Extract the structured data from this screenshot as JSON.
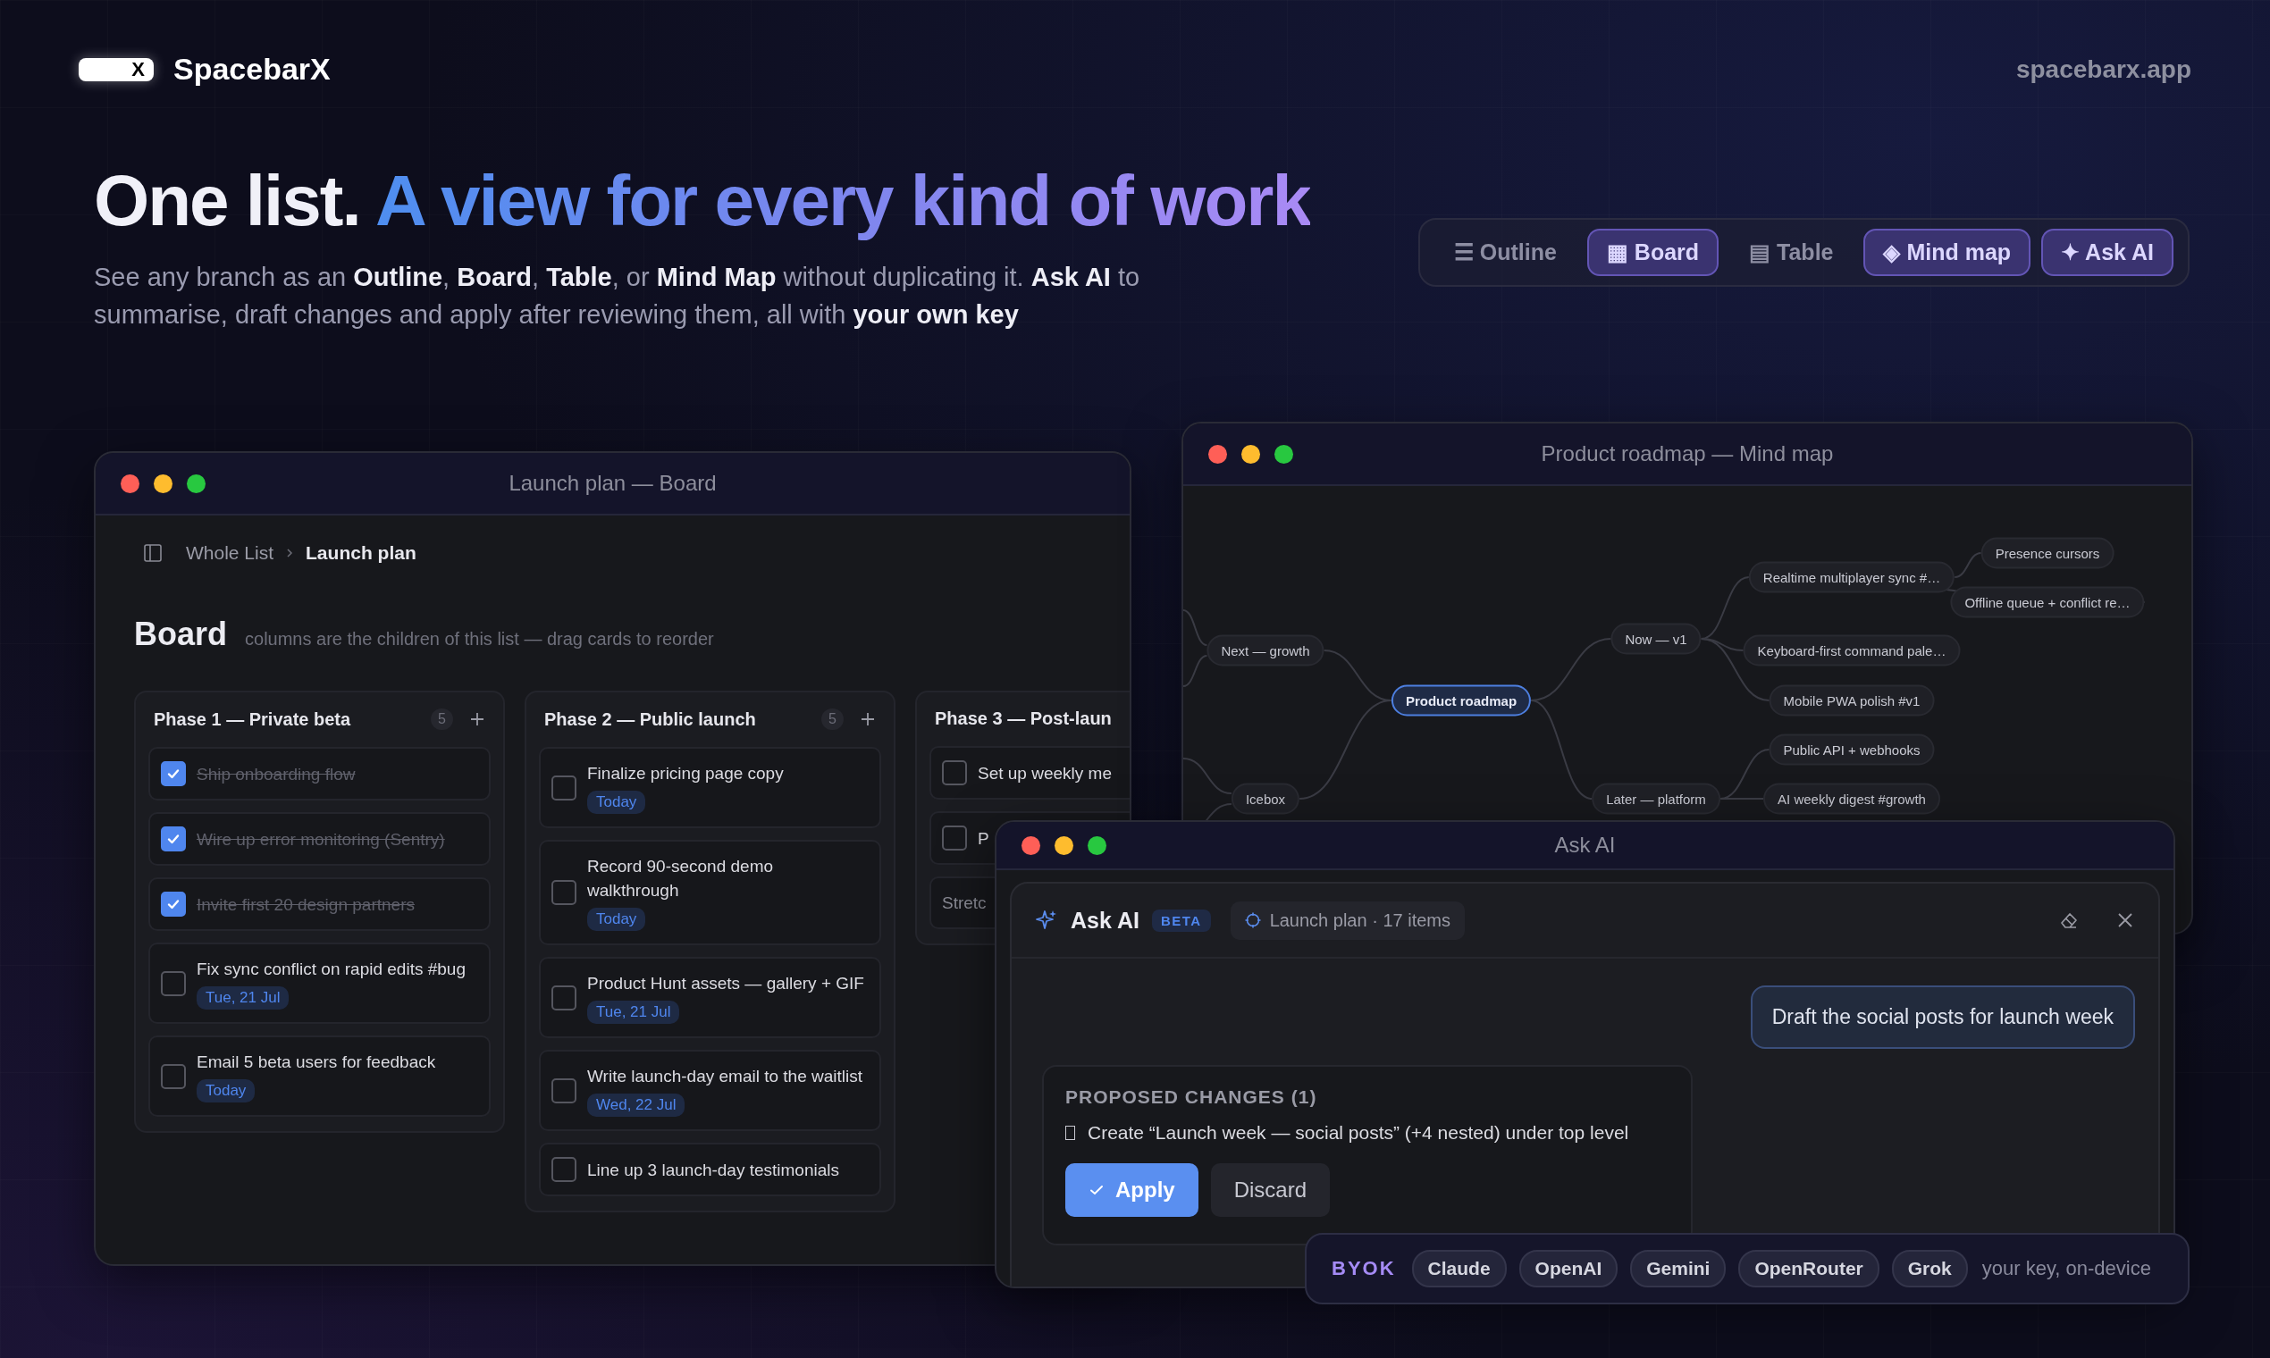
{
  "brand": {
    "mark": "X",
    "name": "SpacebarX",
    "domain": "spacebarx.app"
  },
  "hero": {
    "lead": "One list.",
    "accent": "A view for every kind of work",
    "subtitle": "See any branch as an **Outline**, **Board**, **Table**, or **Mind Map** without duplicating it. **Ask AI** to summarise, draft changes and apply after reviewing them, all with **your own key**"
  },
  "views": [
    {
      "icon": "☰",
      "label": "Outline",
      "selected": false
    },
    {
      "icon": "▦",
      "label": "Board",
      "selected": true
    },
    {
      "icon": "▤",
      "label": "Table",
      "selected": false
    },
    {
      "icon": "◈",
      "label": "Mind map",
      "selected": true
    },
    {
      "icon": "✦",
      "label": "Ask AI",
      "selected": true
    }
  ],
  "board_window": {
    "title": "Launch plan — Board",
    "breadcrumb": [
      {
        "label": "Whole List",
        "current": false
      },
      {
        "label": "Launch plan",
        "current": true
      }
    ],
    "heading": "Board",
    "hint": "columns are the children of this list — drag cards to reorder",
    "columns": [
      {
        "title": "Phase 1 — Private beta",
        "count": "5",
        "cards": [
          {
            "text": "Ship onboarding flow",
            "done": true
          },
          {
            "text": "Wire up error monitoring (Sentry)",
            "done": true
          },
          {
            "text": "Invite first 20 design partners",
            "done": true
          },
          {
            "text": "Fix sync conflict on rapid edits #bug",
            "done": false,
            "tag": "Tue, 21 Jul"
          },
          {
            "text": "Email 5 beta users for feedback",
            "done": false,
            "tag": "Today"
          }
        ]
      },
      {
        "title": "Phase 2 — Public launch",
        "count": "5",
        "cards": [
          {
            "text": "Finalize pricing page copy",
            "done": false,
            "tag": "Today"
          },
          {
            "text": "Record 90-second demo walkthrough",
            "done": false,
            "tag": "Today"
          },
          {
            "text": "Product Hunt assets — gallery + GIF",
            "done": false,
            "tag": "Tue, 21 Jul"
          },
          {
            "text": "Write launch-day email to the waitlist",
            "done": false,
            "tag": "Wed, 22 Jul"
          },
          {
            "text": "Line up 3 launch-day testimonials",
            "done": false
          }
        ]
      },
      {
        "title": "Phase 3 — Post-laun",
        "cards": [
          {
            "kind": "task",
            "text": "Set up weekly me",
            "done": false
          },
          {
            "kind": "task",
            "text": "P",
            "done": false
          },
          {
            "kind": "plain",
            "text": "Stretc"
          }
        ]
      }
    ]
  },
  "mindmap_window": {
    "title": "Product roadmap — Mind map",
    "root": {
      "label": "Product roadmap",
      "selected": true,
      "children": [
        {
          "label": "Now — v1",
          "selected": false,
          "children": [
            {
              "label": "Realtime multiplayer sync #…",
              "selected": false,
              "children": [
                {
                  "label": "Presence cursors",
                  "selected": false
                },
                {
                  "label": "Offline queue + conflict re…",
                  "selected": false
                }
              ]
            },
            {
              "label": "Keyboard-first command pale…",
              "selected": false
            },
            {
              "label": "Mobile PWA polish #v1",
              "selected": false
            }
          ]
        },
        {
          "label": "Later — platform",
          "selected": false,
          "children": [
            {
              "label": "Public API + webhooks",
              "selected": false
            },
            {
              "label": "AI weekly digest #growth",
              "selected": false
            }
          ]
        },
        {
          "label": "Next — growth",
          "selected": false
        },
        {
          "label": "Icebox",
          "selected": false
        }
      ]
    }
  },
  "ask_window": {
    "title": "Ask AI",
    "panel_title": "Ask AI",
    "badge": "BETA",
    "scope": "Launch plan · 17 items",
    "user_message": "Draft the social posts for launch week",
    "proposal": {
      "heading": "PROPOSED CHANGES (1)",
      "items": [
        "Create “Launch week — social posts” (+4 nested) under top level"
      ],
      "buttons": [
        {
          "label": "Apply",
          "kind": "primary"
        },
        {
          "label": "Discard",
          "kind": "secondary"
        }
      ]
    }
  },
  "byok": {
    "label": "BYOK",
    "providers": [
      "Claude",
      "OpenAI",
      "Gemini",
      "OpenRouter",
      "Grok"
    ],
    "note": "your key, on-device"
  }
}
